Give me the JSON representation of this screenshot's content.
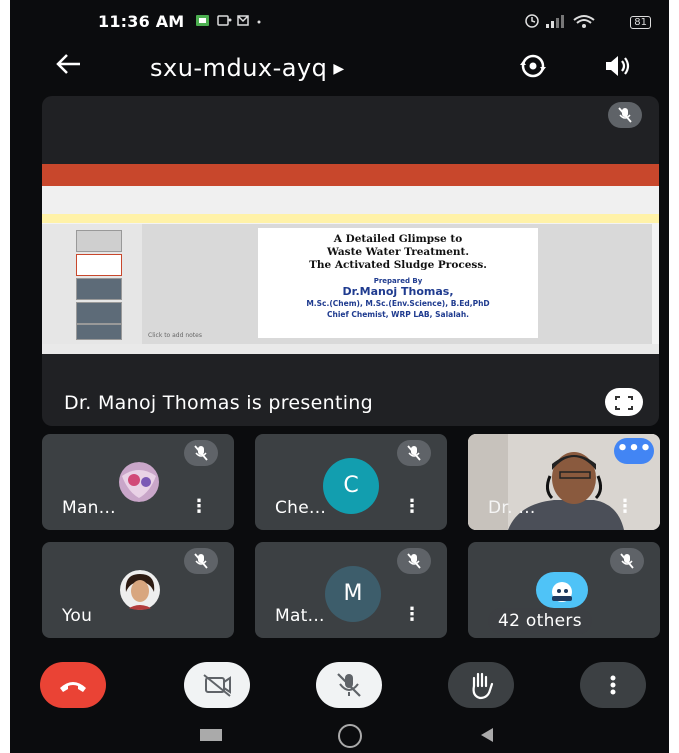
{
  "status_bar": {
    "time": "11:36 AM",
    "battery": "81"
  },
  "header": {
    "meeting_code": "sxu-mdux-ayq"
  },
  "presentation": {
    "presenter_label": "Dr. Manoj Thomas is presenting",
    "slide": {
      "title_lines": [
        "A Detailed Glimpse to",
        "Waste Water Treatment.",
        "The Activated Sludge Process."
      ],
      "prepared_by": "Prepared By",
      "author": "Dr.Manoj Thomas,",
      "degrees": "M.Sc.(Chem), M.Sc.(Env.Science), B.Ed,PhD",
      "designation": "Chief Chemist, WRP LAB, Salalah.",
      "notes_placeholder": "Click to add notes"
    }
  },
  "participants": [
    {
      "name": "Man...",
      "avatar": "photo"
    },
    {
      "name": "Che...",
      "initial": "C",
      "color": "#129eaf"
    },
    {
      "name": "Dr. ...",
      "avatar": "video"
    },
    {
      "name": "You",
      "avatar": "photo"
    },
    {
      "name": "Mat...",
      "initial": "M",
      "color": "#3d5d6b"
    },
    {
      "name": "42 others",
      "avatar": "group"
    }
  ],
  "colors": {
    "end_call": "#ea4335",
    "tile": "#3c4043",
    "background": "#0b0c0e"
  },
  "controls": [
    "end-call",
    "camera-off",
    "mic-off",
    "raise-hand",
    "more-options"
  ]
}
